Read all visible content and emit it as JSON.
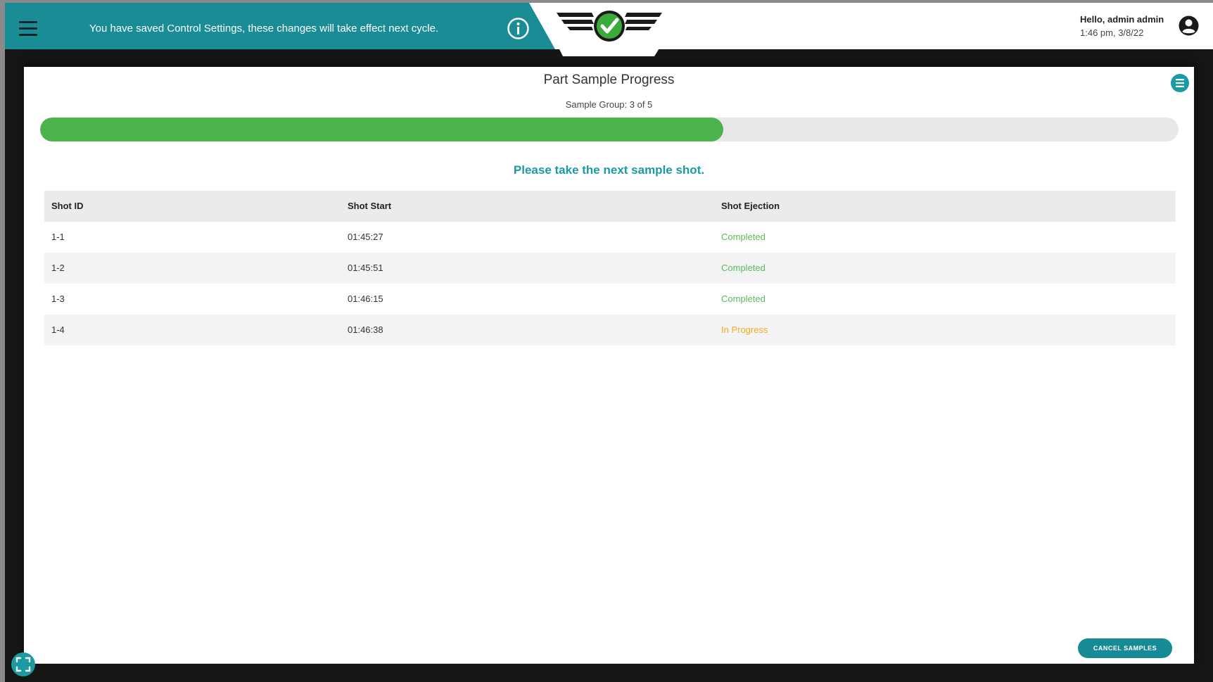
{
  "header": {
    "menu_icon": "hamburger-icon",
    "banner_message": "You have saved Control Settings, these changes will take effect next cycle.",
    "info_icon": "info-icon",
    "logo_icon": "checkmark-wings-logo",
    "user_greeting": "Hello, admin admin",
    "user_timestamp": "1:46 pm, 3/8/22",
    "account_icon": "account-circle-icon"
  },
  "panel": {
    "title": "Part Sample Progress",
    "subtitle": "Sample Group: 3 of 5",
    "menu_icon": "list-menu-icon",
    "progress_fraction": 0.6,
    "prompt": "Please take the next sample shot.",
    "table": {
      "columns": [
        "Shot ID",
        "Shot Start",
        "Shot Ejection"
      ],
      "rows": [
        {
          "id": "1-1",
          "start": "01:45:27",
          "ejection": "Completed"
        },
        {
          "id": "1-2",
          "start": "01:45:51",
          "ejection": "Completed"
        },
        {
          "id": "1-3",
          "start": "01:46:15",
          "ejection": "Completed"
        },
        {
          "id": "1-4",
          "start": "01:46:38",
          "ejection": "In Progress"
        }
      ]
    },
    "cancel_label": "CANCEL SAMPLES"
  },
  "footer": {
    "fullscreen_icon": "fullscreen-icon"
  },
  "colors": {
    "teal": "#1a8c96",
    "progress_green": "#4cb24c",
    "completed": "#5cb85c",
    "in_progress": "#f0ad1e"
  }
}
